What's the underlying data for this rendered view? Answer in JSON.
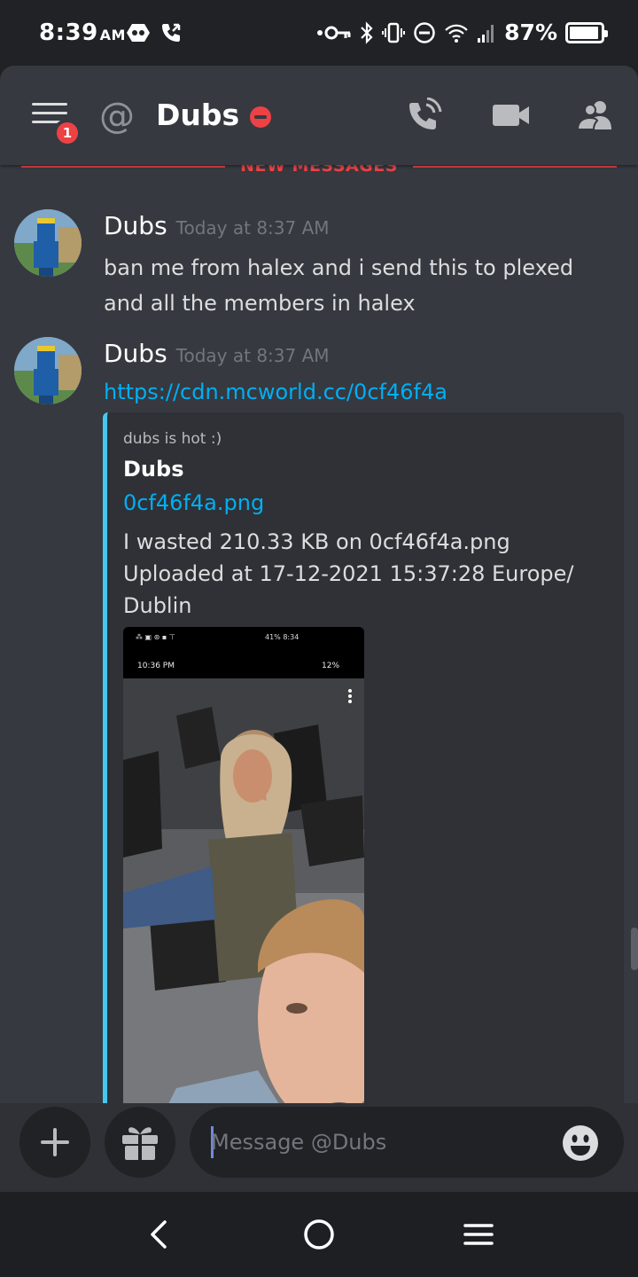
{
  "status_bar": {
    "time": "8:39",
    "ampm": "AM",
    "battery": "87%",
    "battery_level": 0.87
  },
  "header": {
    "at_symbol": "@",
    "channel_name": "Dubs",
    "menu_badge": "1",
    "icons": [
      "hamburger-menu-icon",
      "voice-call-icon",
      "video-call-icon",
      "members-icon"
    ]
  },
  "divider": {
    "label": "NEW MESSAGES"
  },
  "messages": [
    {
      "author": "Dubs",
      "timestamp": "Today at 8:37 AM",
      "text": "ban me from halex and i send this to plexed and all the members in halex"
    },
    {
      "author": "Dubs",
      "timestamp": "Today at 8:37 AM",
      "link": "https://cdn.mcworld.cc/0cf46f4a",
      "embed": {
        "provider": "dubs is hot :)",
        "author": "Dubs",
        "title": "0cf46f4a.png",
        "description_line1": "I wasted 210.33 KB on 0cf46f4a.png",
        "description_line2": "Uploaded at 17-12-2021 15:37:28 Europe/",
        "description_line3": "Dublin",
        "image_status_time_top": "",
        "image_status_time": "10:36 PM",
        "image_status_battery": "12%",
        "image_status_battery_top": "41% 8:34"
      }
    }
  ],
  "composer": {
    "placeholder": "Message @Dubs"
  },
  "colors": {
    "background": "#36393f",
    "header": "#36393f",
    "accent_red": "#ed4245",
    "link": "#00aff4",
    "embed_border": "#45c8f0"
  }
}
